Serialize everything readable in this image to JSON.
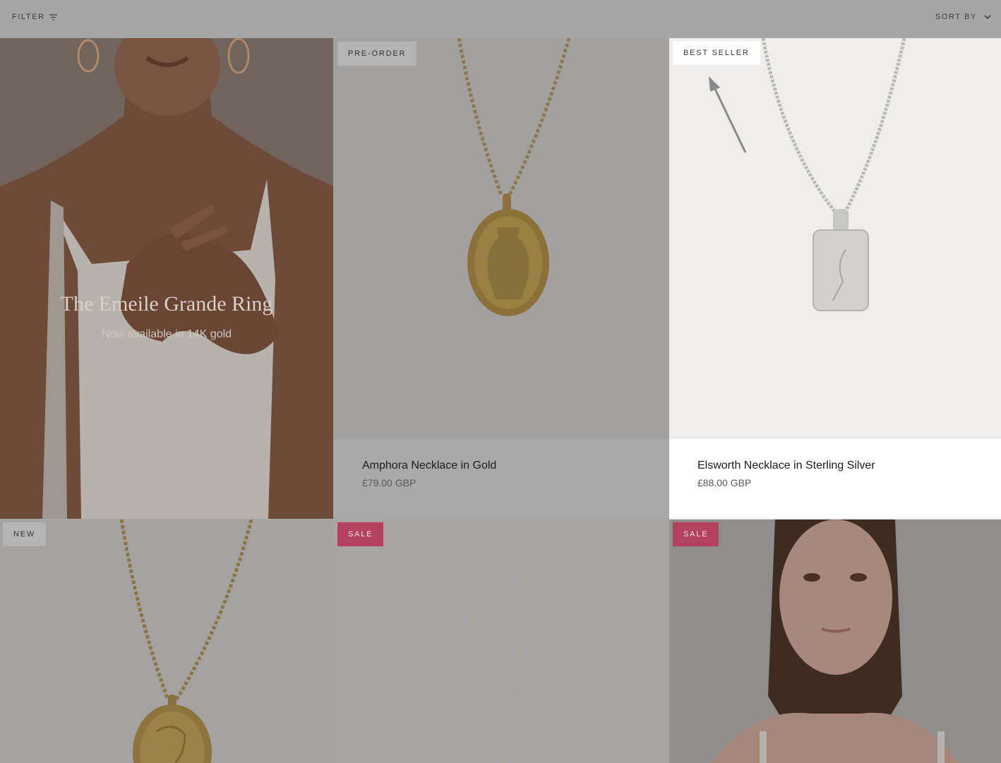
{
  "toolbar": {
    "filter_label": "FILTER",
    "filter_icon": "filter-icon",
    "sort_label": "SORT BY",
    "sort_icon": "chevron-down-icon"
  },
  "promo": {
    "title": "The Emeile Grande Ring",
    "subtitle": "Now available in 14K gold"
  },
  "products": [
    {
      "badge": "PRE-ORDER",
      "title": "Amphora Necklace in Gold",
      "price": "£79.00 GBP"
    },
    {
      "badge": "BEST SELLER",
      "title": "Elsworth Necklace in Sterling Silver",
      "price": "£88.00 GBP"
    },
    {
      "badge": "NEW"
    },
    {
      "badge": "SALE"
    },
    {
      "badge": "SALE"
    }
  ],
  "colors": {
    "overlay": "#a9a9a9",
    "sale_badge": "#b5405d",
    "highlight_tile": "#efeeec"
  }
}
